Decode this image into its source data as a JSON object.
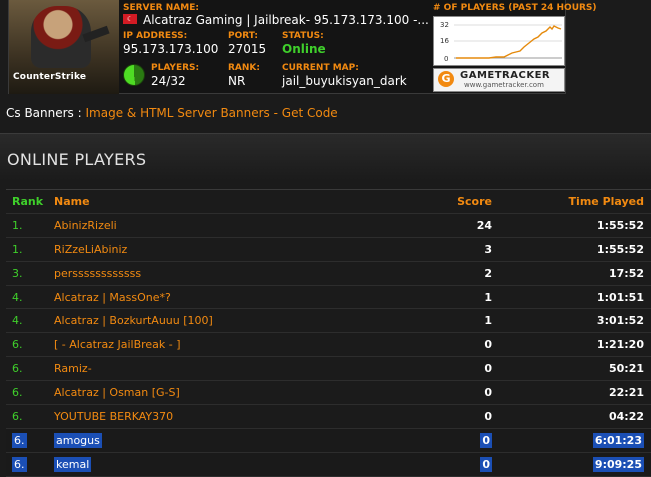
{
  "banner": {
    "logo_text": "CounterStrike",
    "server_name_label": "SERVER NAME:",
    "server_name": "Alcatraz Gaming | Jailbreak- 95.173.173.100 -...",
    "ip_label": "IP ADDRESS:",
    "ip": "95.173.173.100",
    "port_label": "PORT:",
    "port": "27015",
    "status_label": "STATUS:",
    "status": "Online",
    "players_label": "PLAYERS:",
    "players": "24/32",
    "rank_label": "RANK:",
    "rank": "NR",
    "map_label": "CURRENT MAP:",
    "map": "jail_buyukisyan_dark",
    "graph_label": "# OF PLAYERS (past 24 hours)",
    "graph_ticks": [
      "32",
      "16",
      "0"
    ],
    "gametracker_name": "GAMETRACKER",
    "gametracker_url": "www.gametracker.com"
  },
  "cs_banners": {
    "label": "Cs Banners :",
    "link": "Image & HTML Server Banners - Get Code"
  },
  "online_players": {
    "title": "ONLINE PLAYERS",
    "columns": {
      "rank": "Rank",
      "name": "Name",
      "score": "Score",
      "time": "Time Played"
    },
    "rows": [
      {
        "rank": "1.",
        "name": "AbinizRizeli",
        "score": "24",
        "time": "1:55:52"
      },
      {
        "rank": "1.",
        "name": "RiZzeLiAbiniz",
        "score": "3",
        "time": "1:55:52"
      },
      {
        "rank": "3.",
        "name": "perssssssssssss",
        "score": "2",
        "time": "17:52"
      },
      {
        "rank": "4.",
        "name": "Alcatraz | MassOne*?",
        "score": "1",
        "time": "1:01:51"
      },
      {
        "rank": "4.",
        "name": "Alcatraz | BozkurtAuuu [100]",
        "score": "1",
        "time": "3:01:52"
      },
      {
        "rank": "6.",
        "name": "[ - Alcatraz JailBreak - ]",
        "score": "0",
        "time": "1:21:20"
      },
      {
        "rank": "6.",
        "name": "Ramiz-",
        "score": "0",
        "time": "50:21"
      },
      {
        "rank": "6.",
        "name": "Alcatraz | Osman [G-S]",
        "score": "0",
        "time": "22:21"
      },
      {
        "rank": "6.",
        "name": "YOUTUBE BERKAY370",
        "score": "0",
        "time": "04:22"
      },
      {
        "rank": "6.",
        "name": "amogus",
        "score": "0",
        "time": "6:01:23",
        "selected": true
      },
      {
        "rank": "6.",
        "name": "kemal",
        "score": "0",
        "time": "9:09:25",
        "selected": true
      }
    ]
  },
  "colors": {
    "accent": "#f28a11",
    "rank_green": "#3fcf2b",
    "selection": "#1b4fb5",
    "background": "#1b1b1b"
  }
}
